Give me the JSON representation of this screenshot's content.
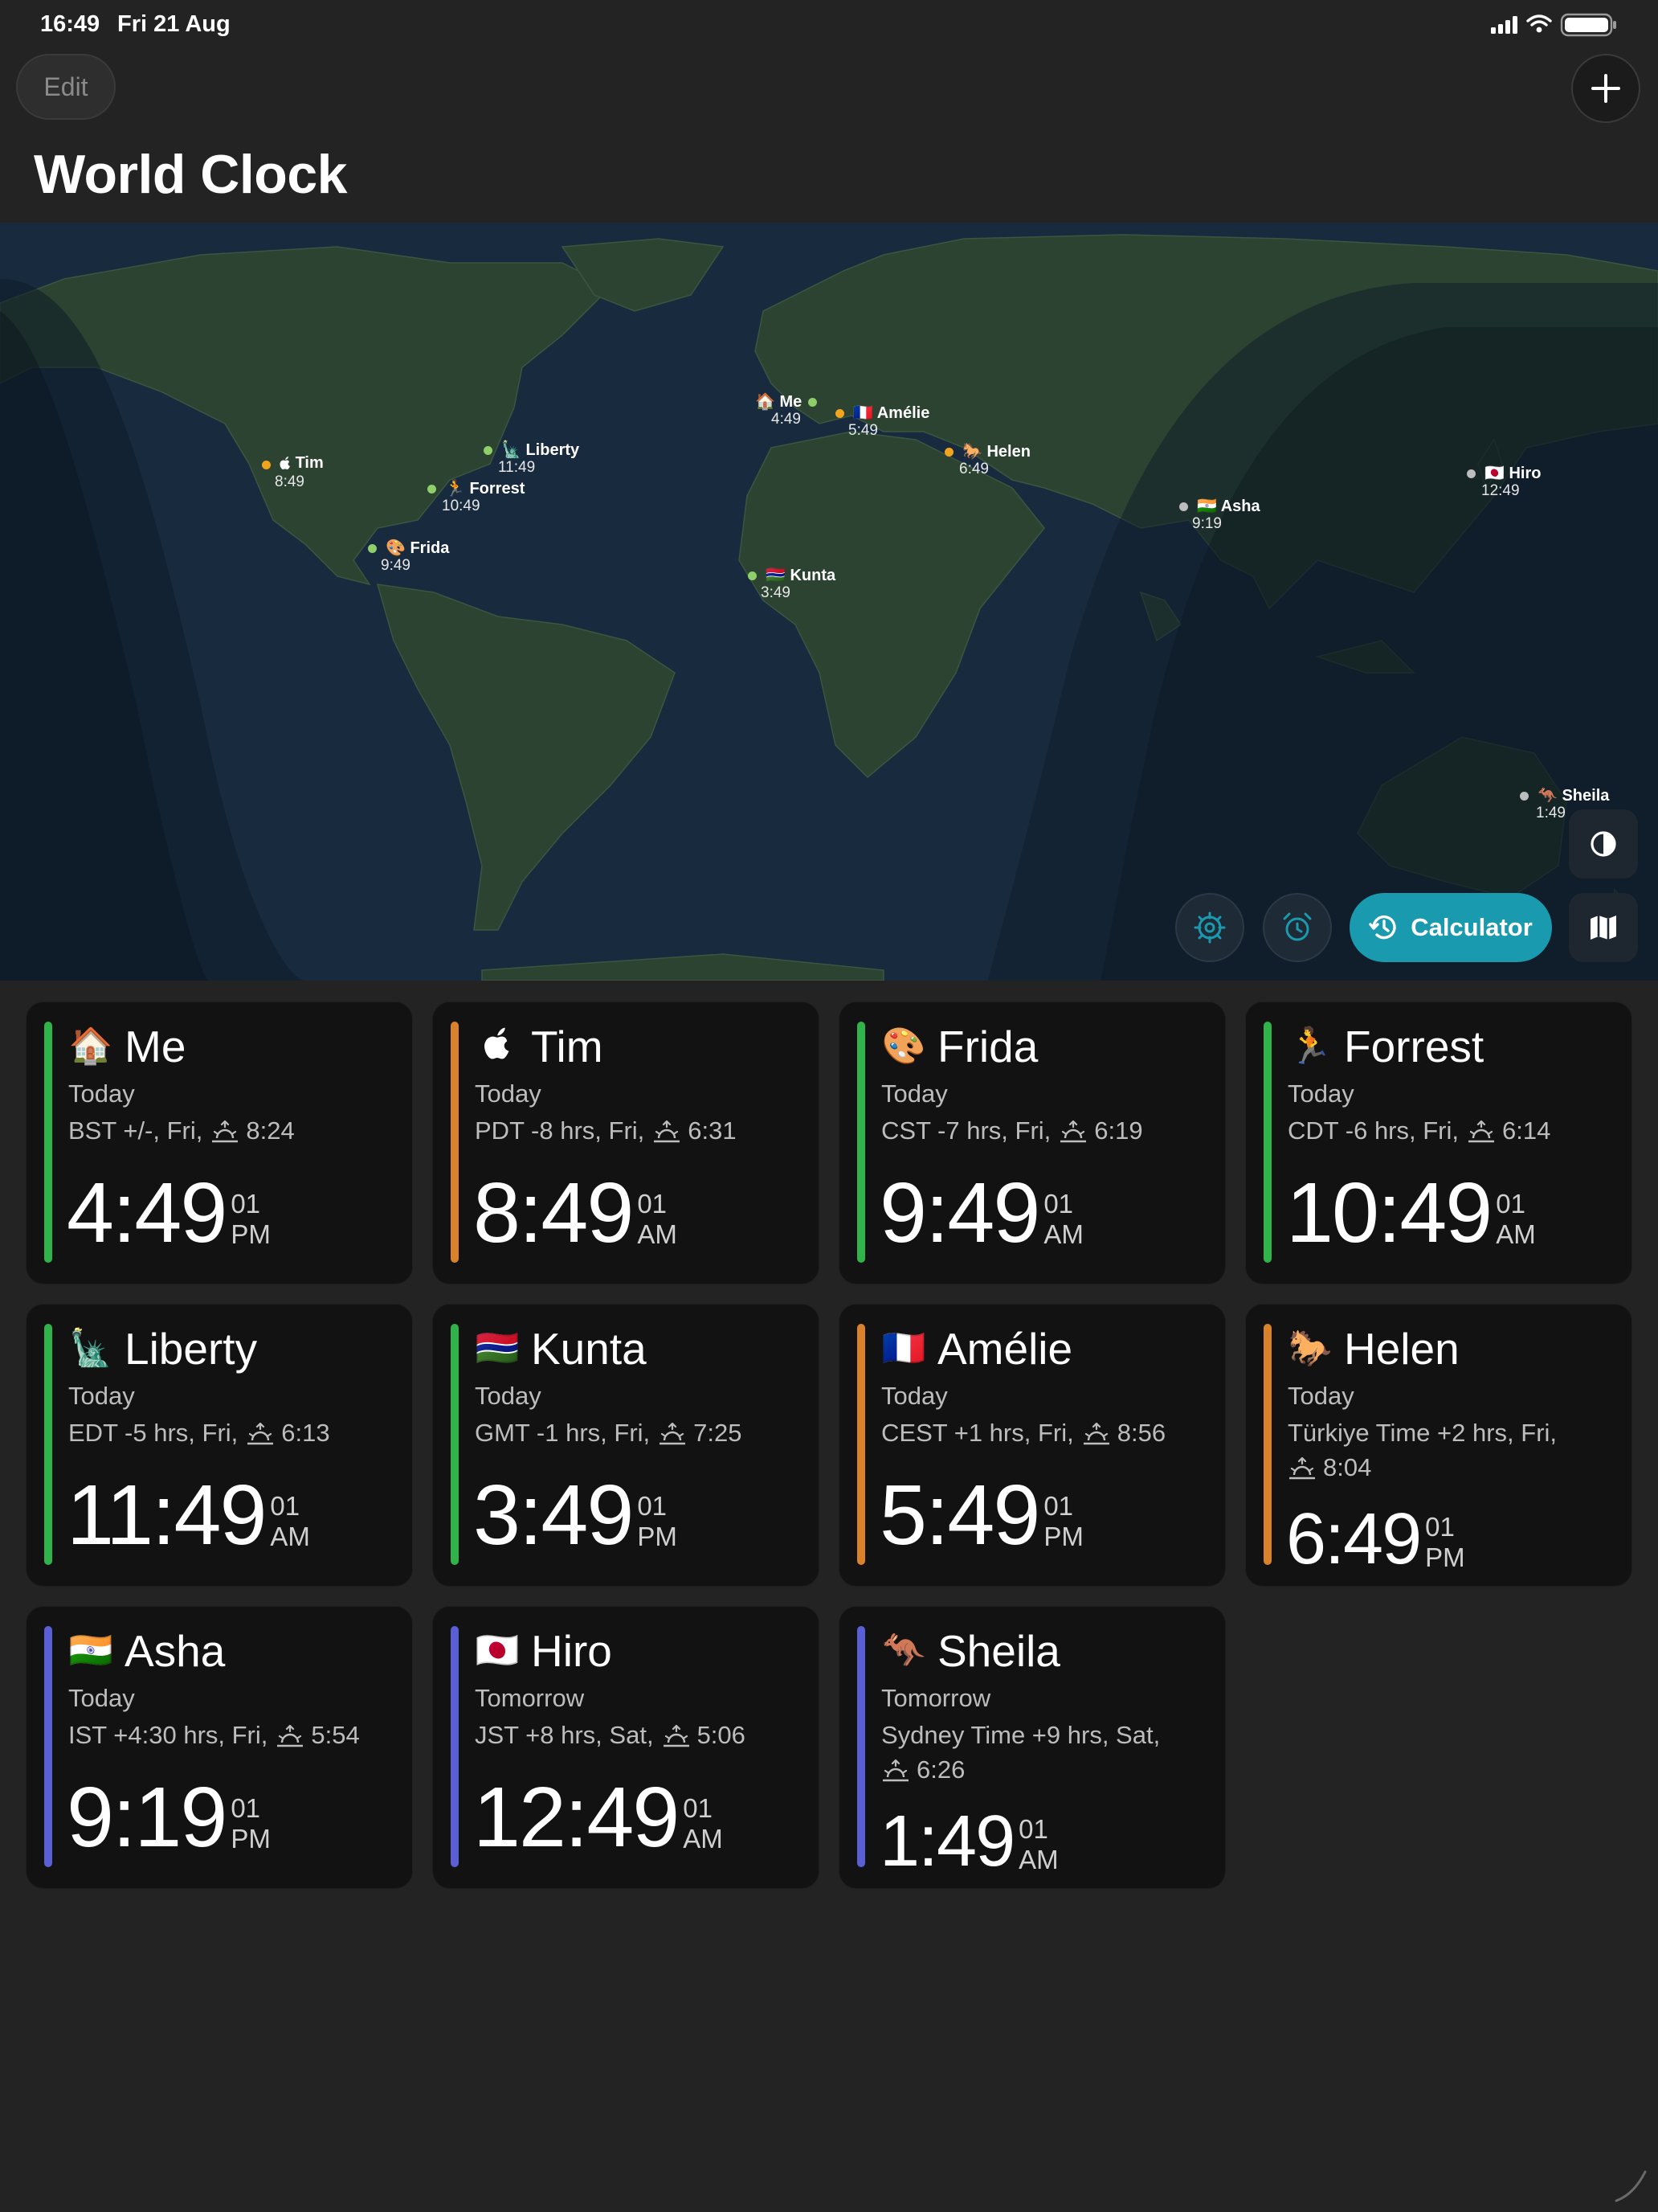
{
  "status_bar": {
    "time": "16:49",
    "date": "Fri 21 Aug"
  },
  "header": {
    "edit_label": "Edit",
    "title": "World Clock"
  },
  "map": {
    "pins": [
      {
        "id": "me",
        "emoji": "🏠",
        "label": "Me",
        "time": "4:49",
        "dot_color": "#8fcf6a"
      },
      {
        "id": "tim",
        "emoji": "",
        "label": "Tim",
        "time": "8:49",
        "dot_color": "#f2a51c"
      },
      {
        "id": "liberty",
        "emoji": "🗽",
        "label": "Liberty",
        "time": "11:49",
        "dot_color": "#8fcf6a"
      },
      {
        "id": "forrest",
        "emoji": "🏃",
        "label": "Forrest",
        "time": "10:49",
        "dot_color": "#8fcf6a"
      },
      {
        "id": "frida",
        "emoji": "🎨",
        "label": "Frida",
        "time": "9:49",
        "dot_color": "#8fcf6a"
      },
      {
        "id": "amelie",
        "emoji": "🇫🇷",
        "label": "Amélie",
        "time": "5:49",
        "dot_color": "#f2a51c"
      },
      {
        "id": "helen",
        "emoji": "🐎",
        "label": "Helen",
        "time": "6:49",
        "dot_color": "#f2a51c"
      },
      {
        "id": "kunta",
        "emoji": "🇬🇲",
        "label": "Kunta",
        "time": "3:49",
        "dot_color": "#8fcf6a"
      },
      {
        "id": "asha",
        "emoji": "🇮🇳",
        "label": "Asha",
        "time": "9:19",
        "dot_color": "#bdbdbd"
      },
      {
        "id": "hiro",
        "emoji": "🇯🇵",
        "label": "Hiro",
        "time": "12:49",
        "dot_color": "#bdbdbd"
      },
      {
        "id": "sheila",
        "emoji": "🦘",
        "label": "Sheila",
        "time": "1:49",
        "dot_color": "#bdbdbd"
      }
    ],
    "calculator_label": "Calculator"
  },
  "clocks": [
    {
      "emoji": "🏠",
      "name": "Me",
      "day": "Today",
      "info": "BST +/-, Fri,",
      "sunrise": "8:24",
      "time": "4:49",
      "seconds": "01",
      "ampm": "PM",
      "accent": "#2fb34a"
    },
    {
      "emoji": "",
      "name": "Tim",
      "day": "Today",
      "info": "PDT -8 hrs, Fri,",
      "sunrise": "6:31",
      "time": "8:49",
      "seconds": "01",
      "ampm": "AM",
      "accent": "#d9822b"
    },
    {
      "emoji": "🎨",
      "name": "Frida",
      "day": "Today",
      "info": "CST -7 hrs, Fri,",
      "sunrise": "6:19",
      "time": "9:49",
      "seconds": "01",
      "ampm": "AM",
      "accent": "#2fb34a"
    },
    {
      "emoji": "🏃",
      "name": "Forrest",
      "day": "Today",
      "info": "CDT -6 hrs, Fri,",
      "sunrise": "6:14",
      "time": "10:49",
      "seconds": "01",
      "ampm": "AM",
      "accent": "#2fb34a"
    },
    {
      "emoji": "🗽",
      "name": "Liberty",
      "day": "Today",
      "info": "EDT -5 hrs, Fri,",
      "sunrise": "6:13",
      "time": "11:49",
      "seconds": "01",
      "ampm": "AM",
      "accent": "#2fb34a"
    },
    {
      "emoji": "🇬🇲",
      "name": "Kunta",
      "day": "Today",
      "info": "GMT -1 hrs, Fri,",
      "sunrise": "7:25",
      "time": "3:49",
      "seconds": "01",
      "ampm": "PM",
      "accent": "#2fb34a"
    },
    {
      "emoji": "🇫🇷",
      "name": "Amélie",
      "day": "Today",
      "info": "CEST +1 hrs, Fri,",
      "sunrise": "8:56",
      "time": "5:49",
      "seconds": "01",
      "ampm": "PM",
      "accent": "#d9822b"
    },
    {
      "emoji": "🐎",
      "name": "Helen",
      "day": "Today",
      "info": "Türkiye Time +2 hrs, Fri,",
      "sunrise": "8:04",
      "time": "6:49",
      "seconds": "01",
      "ampm": "PM",
      "accent": "#d9822b"
    },
    {
      "emoji": "🇮🇳",
      "name": "Asha",
      "day": "Today",
      "info": "IST +4:30 hrs, Fri,",
      "sunrise": "5:54",
      "time": "9:19",
      "seconds": "01",
      "ampm": "PM",
      "accent": "#5a5fd6"
    },
    {
      "emoji": "🇯🇵",
      "name": "Hiro",
      "day": "Tomorrow",
      "info": "JST +8 hrs, Sat,",
      "sunrise": "5:06",
      "time": "12:49",
      "seconds": "01",
      "ampm": "AM",
      "accent": "#5a5fd6"
    },
    {
      "emoji": "🦘",
      "name": "Sheila",
      "day": "Tomorrow",
      "info": "Sydney Time +9 hrs, Sat,",
      "sunrise": "6:26",
      "time": "1:49",
      "seconds": "01",
      "ampm": "AM",
      "accent": "#5a5fd6"
    }
  ]
}
